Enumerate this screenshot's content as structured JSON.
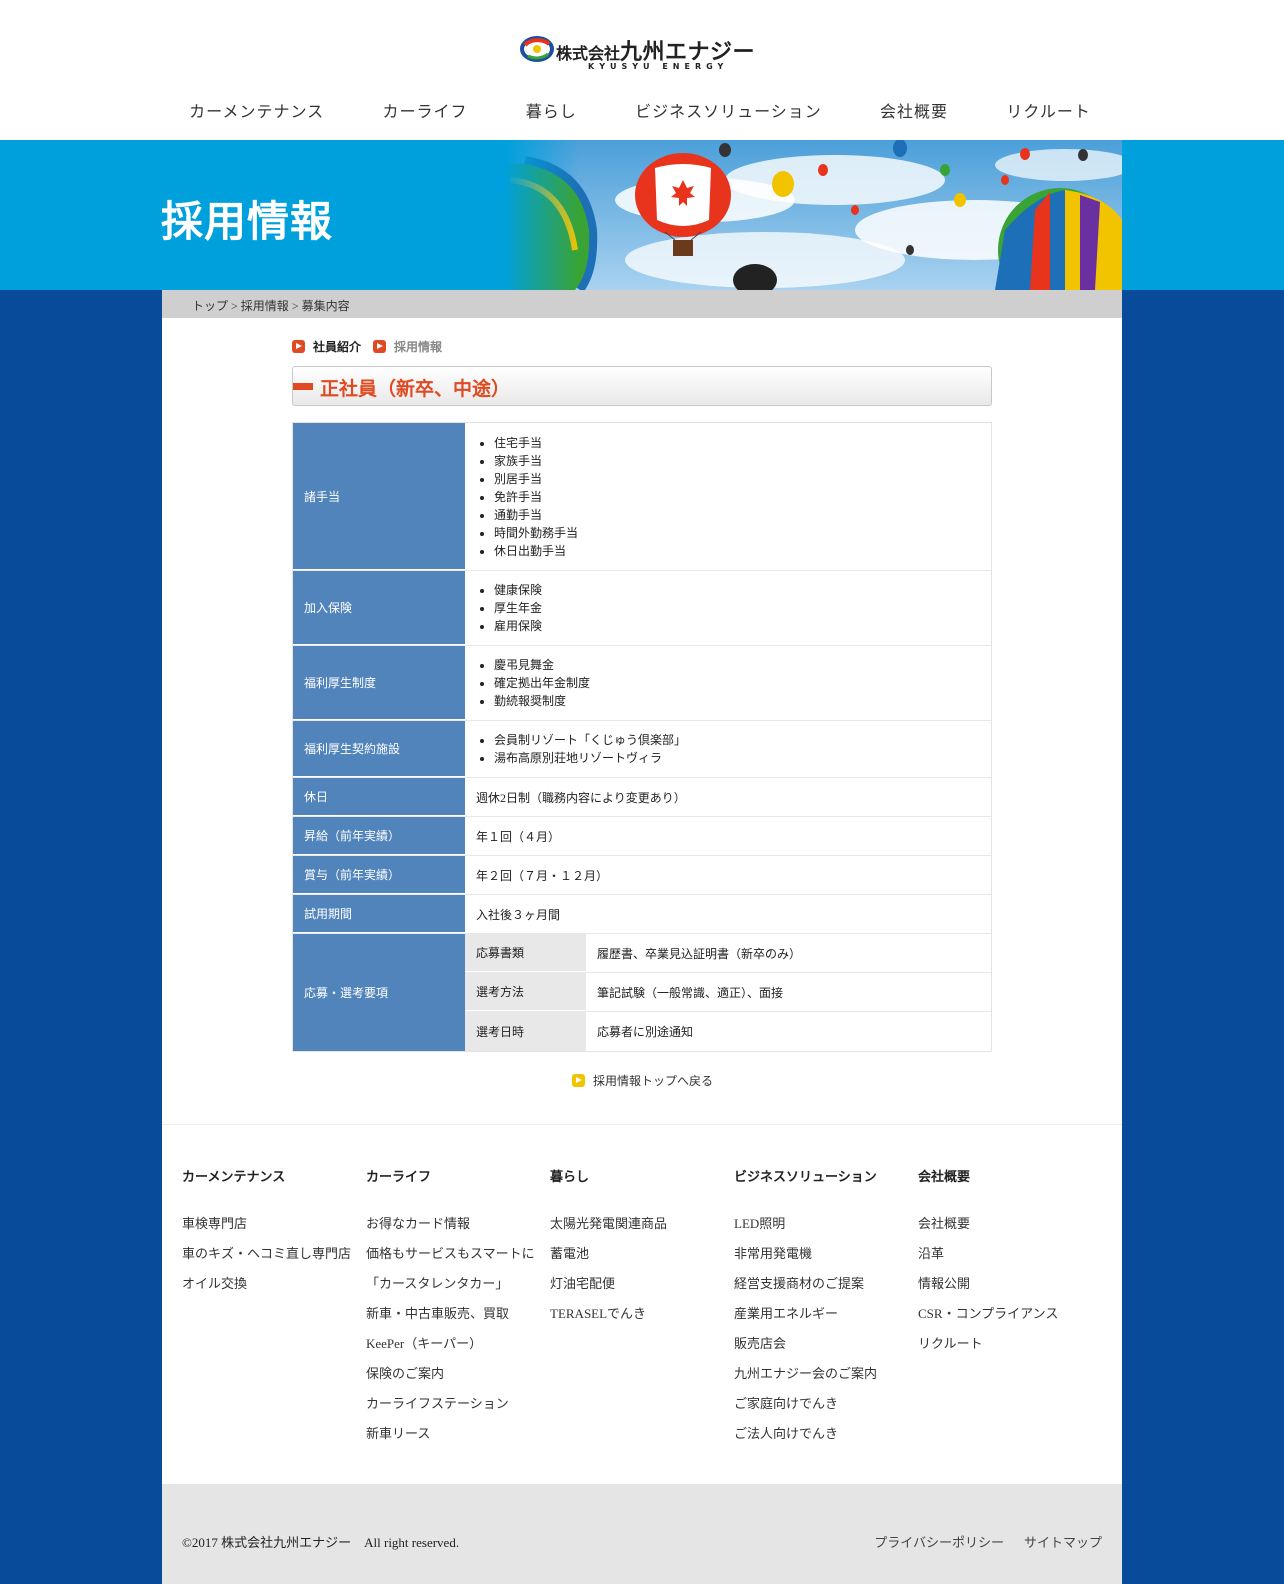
{
  "brand": {
    "name_small": "株式会社",
    "name_big": "九州エナジー",
    "name_en": "KYUSYU ENERGY"
  },
  "gnav": [
    "カーメンテナンス",
    "カーライフ",
    "暮らし",
    "ビジネスソリューション",
    "会社概要",
    "リクルート"
  ],
  "hero": {
    "title": "採用情報"
  },
  "breadcrumb": {
    "top": "トップ",
    "recruit": "採用情報",
    "current": "募集内容",
    "sep": ">"
  },
  "subnav": {
    "staff": "社員紹介",
    "recruit": "採用情報"
  },
  "section_title": "正社員（新卒、中途）",
  "table": {
    "allowances": {
      "label": "諸手当",
      "items": [
        "住宅手当",
        "家族手当",
        "別居手当",
        "免許手当",
        "通勤手当",
        "時間外勤務手当",
        "休日出勤手当"
      ]
    },
    "insurance": {
      "label": "加入保険",
      "items": [
        "健康保険",
        "厚生年金",
        "雇用保険"
      ]
    },
    "welfare": {
      "label": "福利厚生制度",
      "items": [
        "慶弔見舞金",
        "確定拠出年金制度",
        "勤続報奨制度"
      ]
    },
    "facilities": {
      "label": "福利厚生契約施設",
      "items": [
        "会員制リゾート「くじゅう倶楽部」",
        "湯布高原別荘地リゾートヴィラ"
      ]
    },
    "holidays": {
      "label": "休日",
      "value": "週休2日制（職務内容により変更あり）"
    },
    "raise": {
      "label": "昇給（前年実績）",
      "value": "年１回（４月）"
    },
    "bonus": {
      "label": "賞与（前年実績）",
      "value": "年２回（７月・１２月）"
    },
    "trial": {
      "label": "試用期間",
      "value": "入社後３ヶ月間"
    },
    "apply": {
      "label": "応募・選考要項",
      "rows": [
        {
          "label": "応募書類",
          "value": "履歴書、卒業見込証明書（新卒のみ）"
        },
        {
          "label": "選考方法",
          "value": "筆記試験（一般常識、適正）、面接"
        },
        {
          "label": "選考日時",
          "value": "応募者に別途通知"
        }
      ]
    }
  },
  "back_link": "採用情報トップへ戻る",
  "footer": {
    "columns": [
      {
        "title": "カーメンテナンス",
        "items": [
          "車検専門店",
          "車のキズ・ヘコミ直し専門店",
          "オイル交換"
        ]
      },
      {
        "title": "カーライフ",
        "items": [
          "お得なカード情報",
          "価格もサービスもスマートに",
          "「カースタレンタカー」",
          "新車・中古車販売、買取",
          "KeePer（キーパー）",
          "保険のご案内",
          "カーライフステーション",
          "新車リース"
        ]
      },
      {
        "title": "暮らし",
        "items": [
          "太陽光発電関連商品",
          "蓄電池",
          "灯油宅配便",
          "TERASELでんき"
        ]
      },
      {
        "title": "ビジネスソリューション",
        "items": [
          "LED照明",
          "非常用発電機",
          "経営支援商材のご提案",
          "産業用エネルギー",
          "販売店会",
          "九州エナジー会のご案内",
          "ご家庭向けでんき",
          "ご法人向けでんき"
        ]
      },
      {
        "title": "会社概要",
        "items": [
          "会社概要",
          "沿革",
          "情報公開",
          "CSR・コンプライアンス",
          "リクルート"
        ]
      }
    ],
    "copyright": "©2017 株式会社九州エナジー　All right reserved.",
    "links": [
      "プライバシーポリシー",
      "サイトマップ"
    ]
  },
  "colors": {
    "hero_blue": "#00a0dc",
    "page_blue": "#084b9b",
    "table_header": "#5284bc",
    "accent_red": "#e04a22"
  }
}
